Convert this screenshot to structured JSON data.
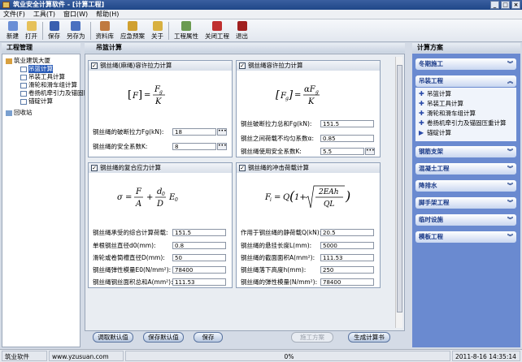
{
  "window": {
    "title": "筑业安全计算软件 - [计算工程]"
  },
  "menu": [
    "文件(F)",
    "工具(T)",
    "窗口(W)",
    "帮助(H)"
  ],
  "toolbar": [
    {
      "label": "新建",
      "icon": "new-file-icon",
      "color": "#6a8ed6"
    },
    {
      "label": "打开",
      "icon": "open-folder-icon",
      "color": "#e6c15a"
    },
    {
      "label": "保存",
      "icon": "save-icon",
      "color": "#3a5fb0"
    },
    {
      "label": "另存为",
      "icon": "save-as-icon",
      "color": "#4a70c0"
    },
    {
      "label": "资料库",
      "icon": "database-icon",
      "color": "#c07a40"
    },
    {
      "label": "应急预案",
      "icon": "emergency-plan-icon",
      "color": "#d0a030"
    },
    {
      "label": "关于",
      "icon": "info-icon",
      "color": "#d8b040"
    },
    {
      "label": "工程属性",
      "icon": "project-properties-icon",
      "color": "#6a9a50"
    },
    {
      "label": "关闭工程",
      "icon": "close-project-icon",
      "color": "#c03030"
    },
    {
      "label": "退出",
      "icon": "exit-icon",
      "color": "#a02020"
    }
  ],
  "left": {
    "header": "工程管理",
    "tree": [
      {
        "label": "筑业建筑大厦",
        "level": 0
      },
      {
        "label": "吊篮计算",
        "level": 1,
        "selected": true
      },
      {
        "label": "吊装工具计算",
        "level": 1
      },
      {
        "label": "滑轮和滑车组计算",
        "level": 1
      },
      {
        "label": "卷扬机牵引力及锚固压重计算",
        "level": 1
      },
      {
        "label": "锚碇计算",
        "level": 1
      },
      {
        "label": "回收站",
        "level": 0
      }
    ]
  },
  "main": {
    "header": "吊篮计算",
    "sections": [
      {
        "title": "钢丝绳(麻绳)容许拉力计算",
        "fields": [
          {
            "label": "钢丝绳的破断拉力Fg(kN):",
            "value": "18",
            "dots": true
          },
          {
            "label": "钢丝绳的安全系数K:",
            "value": "8",
            "dots": true
          }
        ]
      },
      {
        "title": "钢丝绳容许拉力计算",
        "fields": [
          {
            "label": "钢丝破断拉力总和Fg(kN):",
            "value": "151.5",
            "dots": false
          },
          {
            "label": "钢丝之间荷载不均匀系数α:",
            "value": "0.85",
            "dots": false
          },
          {
            "label": "钢丝绳使用安全系数K:",
            "value": "5.5",
            "dots": true
          }
        ]
      },
      {
        "title": "钢丝绳的复合应力计算",
        "fields": [
          {
            "label": "钢丝绳承受的综合计算荷载:",
            "value": "151.5",
            "dots": false
          },
          {
            "label": "单根钢丝直径d0(mm):",
            "value": "0.8",
            "dots": false
          },
          {
            "label": "滑轮或卷筒槽直径D(mm):",
            "value": "50",
            "dots": false
          },
          {
            "label": "钢丝绳弹性模量E0(N/mm²):",
            "value": "78400",
            "dots": false
          },
          {
            "label": "钢丝绳钢丝面积总和A(mm²):",
            "value": "111.53",
            "dots": false
          }
        ]
      },
      {
        "title": "钢丝绳的冲击荷载计算",
        "fields": [
          {
            "label": "作用于钢丝绳的静荷载Q(kN):",
            "value": "20.5",
            "dots": false
          },
          {
            "label": "钢丝绳的悬挂长度L(mm):",
            "value": "5000",
            "dots": false
          },
          {
            "label": "钢丝绳的截面面积A(mm²):",
            "value": "111.53",
            "dots": false
          },
          {
            "label": "钢丝绳落下高度h(mm):",
            "value": "250",
            "dots": false
          },
          {
            "label": "钢丝绳的弹性模量(N/mm²):",
            "value": "78400",
            "dots": false
          }
        ]
      }
    ],
    "buttons": [
      {
        "label": "调取默认值",
        "enabled": true
      },
      {
        "label": "保存默认值",
        "enabled": true
      },
      {
        "label": "保存",
        "enabled": true
      },
      {
        "label": "施工方案",
        "enabled": false
      },
      {
        "label": "生成计算书",
        "enabled": true
      }
    ]
  },
  "right": {
    "header": "计算方案",
    "categories": [
      {
        "label": "冬期施工",
        "expanded": false
      },
      {
        "label": "吊装工程",
        "expanded": true,
        "items": [
          "吊篮计算",
          "吊装工具计算",
          "滑轮和滑车组计算",
          "卷扬机牵引力及锚固压重计算",
          "锚碇计算"
        ]
      },
      {
        "label": "钢筋支架",
        "expanded": false
      },
      {
        "label": "混凝土工程",
        "expanded": false
      },
      {
        "label": "降排水",
        "expanded": false
      },
      {
        "label": "脚手架工程",
        "expanded": false
      },
      {
        "label": "临时设施",
        "expanded": false
      },
      {
        "label": "模板工程",
        "expanded": false
      }
    ]
  },
  "status": {
    "company": "筑业软件",
    "website": "www.yzusuan.com",
    "progress": "0%",
    "datetime": "2011-8-16 14:35:14"
  }
}
